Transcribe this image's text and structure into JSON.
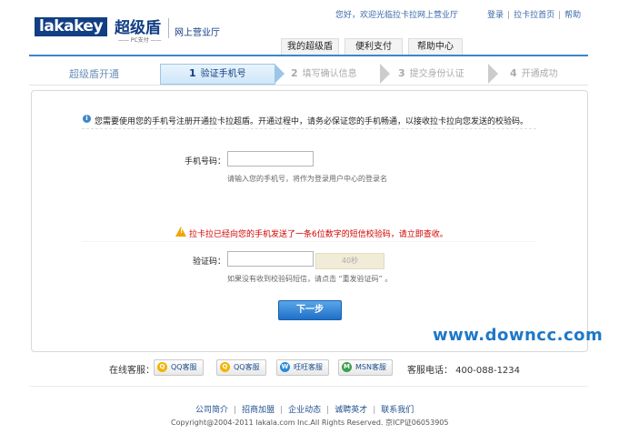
{
  "header": {
    "logo_en": "lakakey",
    "logo_cn": "超级盾",
    "logo_sub": "PC支付",
    "portal": "网上营业厅",
    "greeting": "您好，欢迎光临拉卡拉网上营业厅",
    "links": [
      "登录",
      "拉卡拉首页",
      "帮助"
    ]
  },
  "nav": {
    "tabs": [
      "我的超级盾",
      "便利支付",
      "帮助中心"
    ]
  },
  "steps": {
    "title": "超级盾开通",
    "items": [
      {
        "num": "1",
        "label": "验证手机号"
      },
      {
        "num": "2",
        "label": "填写确认信息"
      },
      {
        "num": "3",
        "label": "提交身份认证"
      },
      {
        "num": "4",
        "label": "开通成功"
      }
    ],
    "active_index": 0
  },
  "form": {
    "info": "您需要使用您的手机号注册开通拉卡拉超盾。开通过程中，请务必保证您的手机畅通，以接收拉卡拉向您发送的校验码。",
    "phone_label": "手机号码：",
    "phone_value": "",
    "phone_hint": "请输入您的手机号，将作为登录用户中心的登录名",
    "warning": "拉卡拉已经向您的手机发送了一条6位数字的短信校验码，请立即查收。",
    "code_label": "验证码：",
    "code_value": "",
    "sms_button": "40秒",
    "code_hint": "如果没有收到校验码短信，请点击 “重发验证码” 。",
    "next_button": "下一步"
  },
  "watermark": "www.downcc.com",
  "service": {
    "label": "在线客服：",
    "buttons": [
      "QQ客服",
      "QQ客服",
      "旺旺客服",
      "MSN客服"
    ],
    "phone": "客服电话：  400-088-1234"
  },
  "footer": {
    "links": [
      "公司简介",
      "招商加盟",
      "企业动态",
      "诚聘英才",
      "联系我们"
    ],
    "copyright": "Copyright@2004-2011 lakala.com Inc.All Rights Reserved. 京ICP证06053905"
  },
  "colors": {
    "brand": "#123e83",
    "accent": "#3e86c7",
    "warning": "#d40000",
    "watermark": "#1e78c8"
  }
}
